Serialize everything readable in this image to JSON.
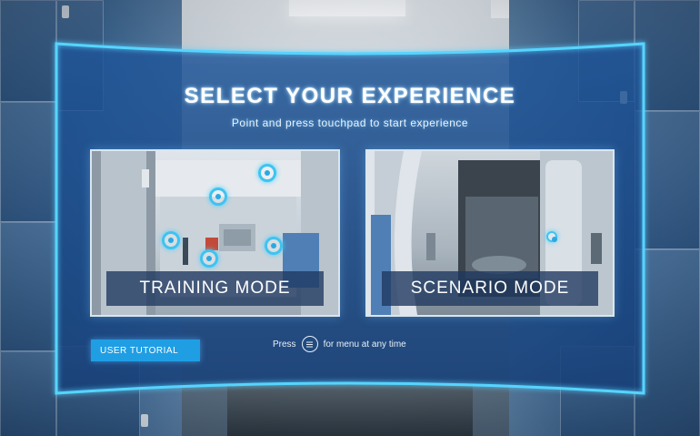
{
  "header": {
    "title": "SELECT YOUR EXPERIENCE",
    "subtitle": "Point and press touchpad to start experience"
  },
  "modes": [
    {
      "label": "TRAINING MODE"
    },
    {
      "label": "SCENARIO MODE"
    }
  ],
  "footer": {
    "tutorial_label": "USER TUTORIAL",
    "hint_prefix": "Press",
    "hint_suffix": "for menu at any time",
    "menu_icon": "menu-icon"
  },
  "colors": {
    "panel": "#1d4a86",
    "panel_glow": "#56d4ff",
    "hotspot": "#3fc3f0",
    "tutorial_button": "#1f9ee4"
  }
}
